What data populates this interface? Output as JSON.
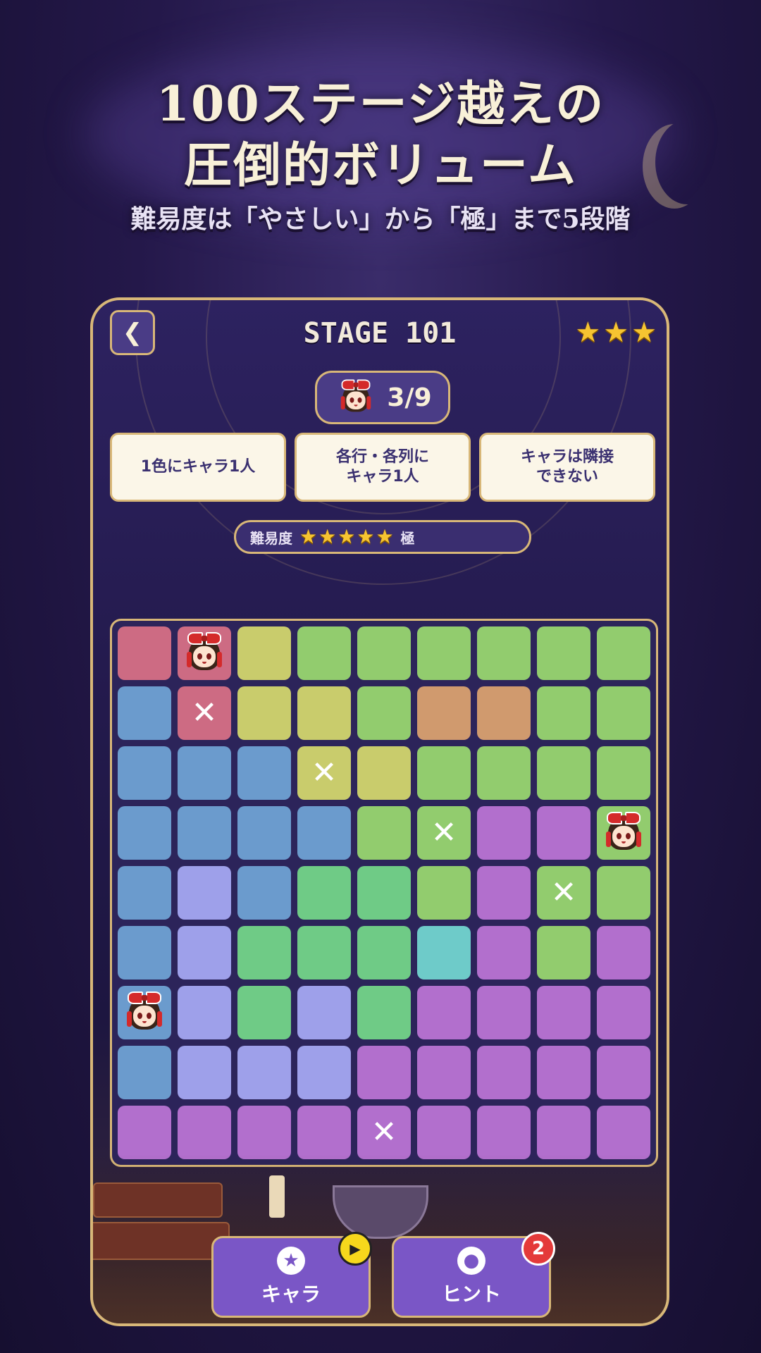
{
  "promo": {
    "headline_line1": "100ステージ越えの",
    "headline_line2": "圧倒的ボリューム",
    "subheadline": "難易度は「やさしい」から「極」まで5段階"
  },
  "header": {
    "back_icon": "chevron-left-icon",
    "stage_title": "STAGE 101",
    "rating_stars": 3
  },
  "progress": {
    "placed": 3,
    "total": 9,
    "label": "3/9"
  },
  "rules": [
    "1色にキャラ1人",
    "各行・各列に\nキャラ1人",
    "キャラは隣接\nできない"
  ],
  "difficulty": {
    "label": "難易度",
    "stars": 5,
    "level": "極"
  },
  "colors": {
    "R": "#cd6b83",
    "Y": "#c9cc6c",
    "G": "#92cc6e",
    "O": "#d09a6e",
    "B": "#6b9bcd",
    "L": "#9ea0ea",
    "M": "#6fcb86",
    "C": "#6ecbc9",
    "P": "#b26fcd"
  },
  "board": {
    "size": 9,
    "regions": [
      [
        "R",
        "R",
        "Y",
        "G",
        "G",
        "G",
        "G",
        "G",
        "G"
      ],
      [
        "B",
        "R",
        "Y",
        "Y",
        "G",
        "O",
        "O",
        "G",
        "G"
      ],
      [
        "B",
        "B",
        "B",
        "Y",
        "Y",
        "G",
        "G",
        "G",
        "G"
      ],
      [
        "B",
        "B",
        "B",
        "B",
        "G",
        "G",
        "P",
        "P",
        "G"
      ],
      [
        "B",
        "L",
        "B",
        "M",
        "M",
        "G",
        "P",
        "G",
        "G"
      ],
      [
        "B",
        "L",
        "M",
        "M",
        "M",
        "C",
        "P",
        "G",
        "P"
      ],
      [
        "B",
        "L",
        "M",
        "L",
        "M",
        "P",
        "P",
        "P",
        "P"
      ],
      [
        "B",
        "L",
        "L",
        "L",
        "P",
        "P",
        "P",
        "P",
        "P"
      ],
      [
        "P",
        "P",
        "P",
        "P",
        "P",
        "P",
        "P",
        "P",
        "P"
      ]
    ],
    "marks": [
      [
        ".",
        "Q",
        ".",
        ".",
        ".",
        ".",
        ".",
        ".",
        "."
      ],
      [
        ".",
        "X",
        ".",
        ".",
        ".",
        ".",
        ".",
        ".",
        "."
      ],
      [
        ".",
        ".",
        ".",
        "X",
        ".",
        ".",
        ".",
        ".",
        "."
      ],
      [
        ".",
        ".",
        ".",
        ".",
        ".",
        "X",
        ".",
        ".",
        "Q"
      ],
      [
        ".",
        ".",
        ".",
        ".",
        ".",
        ".",
        ".",
        "X",
        "."
      ],
      [
        ".",
        ".",
        ".",
        ".",
        ".",
        ".",
        ".",
        ".",
        "."
      ],
      [
        "Q",
        ".",
        ".",
        ".",
        ".",
        ".",
        ".",
        ".",
        "."
      ],
      [
        ".",
        ".",
        ".",
        ".",
        ".",
        ".",
        ".",
        ".",
        "."
      ],
      [
        ".",
        ".",
        ".",
        ".",
        "X",
        ".",
        ".",
        ".",
        "."
      ]
    ],
    "mark_glyph": "✕"
  },
  "buttons": {
    "chara_label": "キャラ",
    "chara_icon": "star-icon",
    "hint_label": "ヒント",
    "hint_icon": "lightbulb-icon",
    "hint_count": "2",
    "video_icon": "play-icon"
  }
}
